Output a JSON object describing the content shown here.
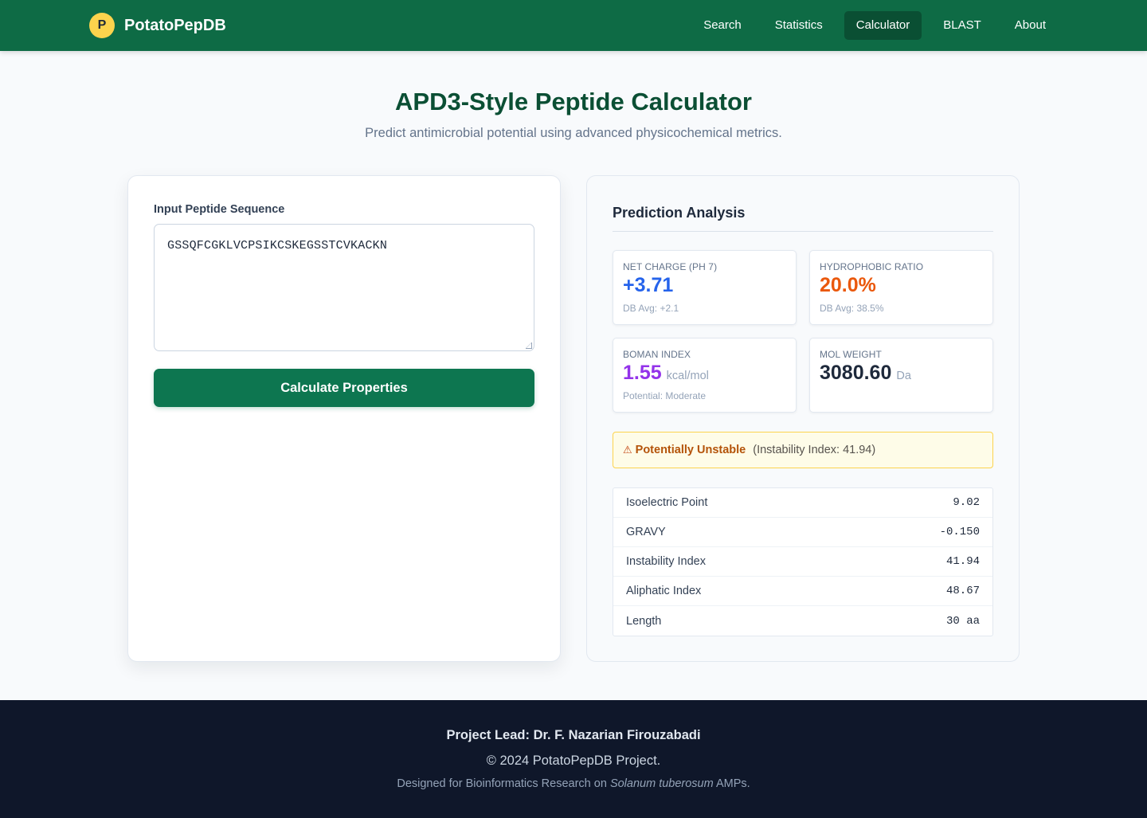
{
  "navbar": {
    "logo_letter": "P",
    "brand": "PotatoPepDB",
    "links": [
      {
        "label": "Search"
      },
      {
        "label": "Statistics"
      },
      {
        "label": "Calculator",
        "active": true
      },
      {
        "label": "BLAST"
      },
      {
        "label": "About"
      }
    ]
  },
  "header": {
    "title": "APD3-Style Peptide Calculator",
    "subtitle": "Predict antimicrobial potential using advanced physicochemical metrics."
  },
  "input": {
    "label": "Input Peptide Sequence",
    "sequence": "GSSQFCGKLVCPSIKCSKEGSSTCVKACKN",
    "button": "Calculate Properties"
  },
  "results": {
    "heading": "Prediction Analysis",
    "metrics": [
      {
        "label": "Net Charge (pH 7)",
        "value": "+3.71",
        "unit": "",
        "note": "DB Avg: +2.1",
        "color": "#2563eb"
      },
      {
        "label": "Hydrophobic Ratio",
        "value": "20.0%",
        "unit": "",
        "note": "DB Avg: 38.5%",
        "color": "#ea580c"
      },
      {
        "label": "Boman Index",
        "value": "1.55",
        "unit": "kcal/mol",
        "note": "Potential: Moderate",
        "color": "#9333ea"
      },
      {
        "label": "Mol Weight",
        "value": "3080.60",
        "unit": "Da",
        "note": "",
        "color": "#1e293b"
      }
    ],
    "warning": {
      "icon": "⚠",
      "text": "Potentially Unstable",
      "detail": "(Instability Index: 41.94)"
    },
    "properties": [
      {
        "name": "Isoelectric Point",
        "value": "9.02"
      },
      {
        "name": "GRAVY",
        "value": "-0.150"
      },
      {
        "name": "Instability Index",
        "value": "41.94"
      },
      {
        "name": "Aliphatic Index",
        "value": "48.67"
      },
      {
        "name": "Length",
        "value": "30 aa"
      }
    ]
  },
  "footer": {
    "lead": "Project Lead: Dr. F. Nazarian Firouzabadi",
    "copyright": "© 2024 PotatoPepDB Project.",
    "note_prefix": "Designed for Bioinformatics Research on",
    "note_species": "Solanum tuberosum",
    "note_suffix": "AMPs."
  }
}
